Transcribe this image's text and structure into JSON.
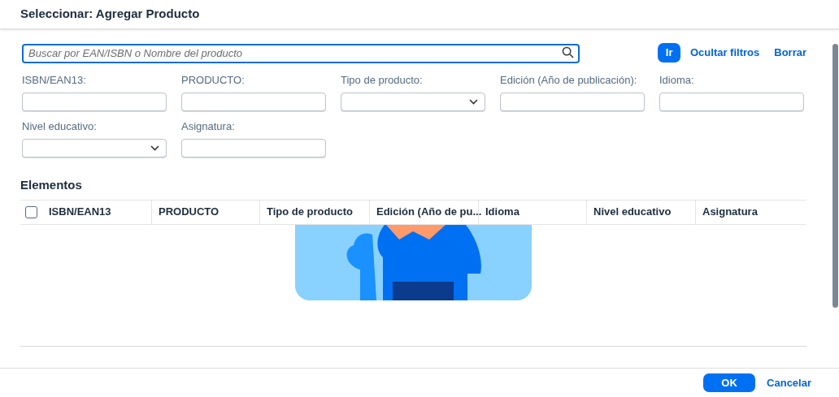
{
  "dialog": {
    "title": "Seleccionar: Agregar Producto"
  },
  "search": {
    "placeholder": "Buscar por EAN/ISBN o Nombre del producto"
  },
  "actions": {
    "go": "Ir",
    "hide_filters": "Ocultar filtros",
    "clear": "Borrar"
  },
  "filters": [
    {
      "label": "ISBN/EAN13:",
      "kind": "input"
    },
    {
      "label": "PRODUCTO:",
      "kind": "input"
    },
    {
      "label": "Tipo de producto:",
      "kind": "select"
    },
    {
      "label": "Edición (Año de publicación):",
      "kind": "input"
    },
    {
      "label": "Idioma:",
      "kind": "input"
    },
    {
      "label": "Nivel educativo:",
      "kind": "select"
    },
    {
      "label": "Asignatura:",
      "kind": "input"
    }
  ],
  "table": {
    "title": "Elementos",
    "select_all": {
      "checked": false
    },
    "columns": [
      "ISBN/EAN13",
      "PRODUCTO",
      "Tipo de producto",
      "Edición (Año de pu...",
      "Idioma",
      "Nivel educativo",
      "Asignatura"
    ]
  },
  "footer": {
    "buttons": [
      {
        "label": "OK",
        "kind": "primary"
      },
      {
        "label": "Cancelar",
        "kind": "link"
      }
    ]
  }
}
